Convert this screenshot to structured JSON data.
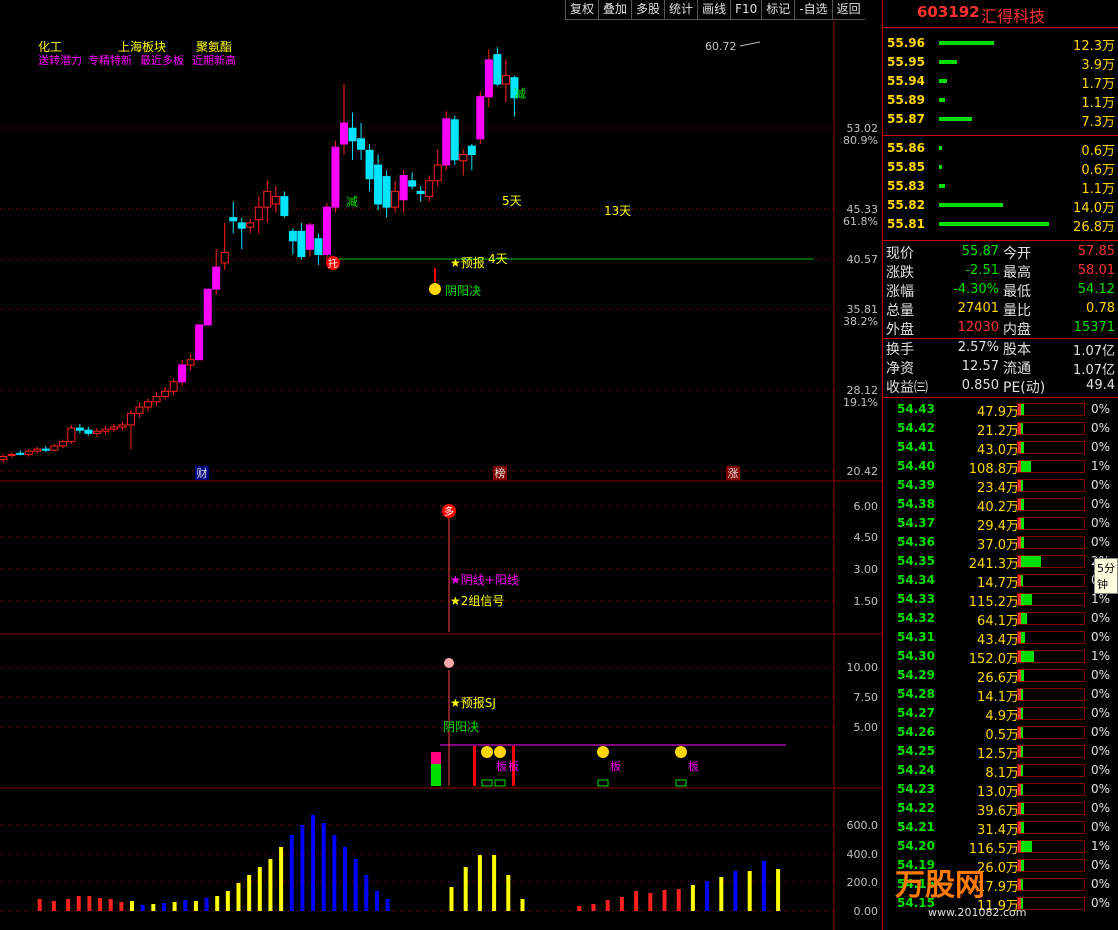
{
  "toolbar": [
    "复权",
    "叠加",
    "多股",
    "统计",
    "画线",
    "F10",
    "标记",
    "-自选",
    "返回"
  ],
  "stock": {
    "code": "603192",
    "name": "汇得科技"
  },
  "main_chart": {
    "legend_row1": [
      "化工",
      "上海板块",
      "聚氨酯"
    ],
    "legend_row2": [
      "送转潜力",
      "专精特新",
      "最近多板",
      "近期新高"
    ],
    "yaxis": [
      {
        "value": "53.02",
        "pct": "80.9%"
      },
      {
        "value": "45.33",
        "pct": "61.8%"
      },
      {
        "value": "40.57",
        "pct": ""
      },
      {
        "value": "35.81",
        "pct": "38.2%"
      },
      {
        "value": "28.12",
        "pct": "19.1%"
      },
      {
        "value": "20.42",
        "pct": ""
      }
    ],
    "high_label": "60.72",
    "annotations": {
      "jian1": "减",
      "jian2": "减",
      "tuo": "托",
      "yubao": "★预报",
      "yinyang": "阴阳决",
      "d5": "5天",
      "d4": "4天",
      "d13": "13天"
    },
    "bottom_markers": [
      "财",
      "榜",
      "涨"
    ]
  },
  "indicator1": {
    "yaxis": [
      "6.00",
      "4.50",
      "3.00",
      "1.50"
    ],
    "marker": "多",
    "labels": [
      "★阴线+阳线",
      "★2组信号"
    ]
  },
  "indicator2": {
    "yaxis": [
      "10.00",
      "7.50",
      "5.00"
    ],
    "labels": {
      "yubao": "★预报SJ",
      "yinyang": "阴阳决",
      "ban": "板"
    }
  },
  "volume": {
    "yaxis": [
      "600.0",
      "400.0",
      "200.0",
      "0.00"
    ]
  },
  "sell_levels": [
    {
      "price": "55.96",
      "vol": "12.3万",
      "bar": 0.5
    },
    {
      "price": "55.95",
      "vol": "3.9万",
      "bar": 0.16
    },
    {
      "price": "55.94",
      "vol": "1.7万",
      "bar": 0.07
    },
    {
      "price": "55.89",
      "vol": "1.1万",
      "bar": 0.05
    },
    {
      "price": "55.87",
      "vol": "7.3万",
      "bar": 0.3
    }
  ],
  "buy_levels": [
    {
      "price": "55.86",
      "vol": "0.6万",
      "bar": 0.03
    },
    {
      "price": "55.85",
      "vol": "0.6万",
      "bar": 0.03
    },
    {
      "price": "55.83",
      "vol": "1.1万",
      "bar": 0.05
    },
    {
      "price": "55.82",
      "vol": "14.0万",
      "bar": 0.58
    },
    {
      "price": "55.81",
      "vol": "26.8万",
      "bar": 1.0
    }
  ],
  "quote": [
    {
      "l1": "现价",
      "v1": "55.87",
      "c1": "grn",
      "l2": "今开",
      "v2": "57.85",
      "c2": "red"
    },
    {
      "l1": "涨跌",
      "v1": "-2.51",
      "c1": "grn",
      "l2": "最高",
      "v2": "58.01",
      "c2": "red"
    },
    {
      "l1": "涨幅",
      "v1": "-4.30%",
      "c1": "grn",
      "l2": "最低",
      "v2": "54.12",
      "c2": "grn"
    },
    {
      "l1": "总量",
      "v1": "27401",
      "c1": "yel",
      "l2": "量比",
      "v2": "0.78",
      "c2": "yel"
    },
    {
      "l1": "外盘",
      "v1": "12030",
      "c1": "red",
      "l2": "内盘",
      "v2": "15371",
      "c2": "grn"
    }
  ],
  "fundamentals": [
    {
      "l1": "换手",
      "v1": "2.57%",
      "l2": "股本",
      "v2": "1.07亿"
    },
    {
      "l1": "净资",
      "v1": "12.57",
      "l2": "流通",
      "v2": "1.07亿"
    },
    {
      "l1": "收益㈢",
      "v1": "0.850",
      "l2": "PE(动)",
      "v2": "49.4"
    }
  ],
  "price_levels": [
    {
      "p": "54.43",
      "v": "47.9万",
      "f": 0.05,
      "pct": "0%"
    },
    {
      "p": "54.42",
      "v": "21.2万",
      "f": 0.03,
      "pct": "0%"
    },
    {
      "p": "54.41",
      "v": "43.0万",
      "f": 0.05,
      "pct": "0%"
    },
    {
      "p": "54.40",
      "v": "108.8万",
      "f": 0.15,
      "pct": "1%"
    },
    {
      "p": "54.39",
      "v": "23.4万",
      "f": 0.03,
      "pct": "0%"
    },
    {
      "p": "54.38",
      "v": "40.2万",
      "f": 0.05,
      "pct": "0%"
    },
    {
      "p": "54.37",
      "v": "29.4万",
      "f": 0.04,
      "pct": "0%"
    },
    {
      "p": "54.36",
      "v": "37.0万",
      "f": 0.05,
      "pct": "0%"
    },
    {
      "p": "54.35",
      "v": "241.3万",
      "f": 0.3,
      "pct": "2%"
    },
    {
      "p": "54.34",
      "v": "14.7万",
      "f": 0.02,
      "pct": "0%"
    },
    {
      "p": "54.33",
      "v": "115.2万",
      "f": 0.16,
      "pct": "1%"
    },
    {
      "p": "54.32",
      "v": "64.1万",
      "f": 0.09,
      "pct": "0%"
    },
    {
      "p": "54.31",
      "v": "43.4万",
      "f": 0.06,
      "pct": "0%"
    },
    {
      "p": "54.30",
      "v": "152.0万",
      "f": 0.2,
      "pct": "1%"
    },
    {
      "p": "54.29",
      "v": "26.6万",
      "f": 0.04,
      "pct": "0%"
    },
    {
      "p": "54.28",
      "v": "14.1万",
      "f": 0.02,
      "pct": "0%"
    },
    {
      "p": "54.27",
      "v": "4.9万",
      "f": 0.01,
      "pct": "0%"
    },
    {
      "p": "54.26",
      "v": "0.5万",
      "f": 0.005,
      "pct": "0%"
    },
    {
      "p": "54.25",
      "v": "12.5万",
      "f": 0.02,
      "pct": "0%"
    },
    {
      "p": "54.24",
      "v": "8.1万",
      "f": 0.01,
      "pct": "0%"
    },
    {
      "p": "54.23",
      "v": "13.0万",
      "f": 0.02,
      "pct": "0%"
    },
    {
      "p": "54.22",
      "v": "39.6万",
      "f": 0.05,
      "pct": "0%"
    },
    {
      "p": "54.21",
      "v": "31.4万",
      "f": 0.04,
      "pct": "0%"
    },
    {
      "p": "54.20",
      "v": "116.5万",
      "f": 0.16,
      "pct": "1%"
    },
    {
      "p": "54.19",
      "v": "26.0万",
      "f": 0.04,
      "pct": "0%"
    },
    {
      "p": "54.16",
      "v": "17.9万",
      "f": 0.03,
      "pct": "0%"
    },
    {
      "p": "54.15",
      "v": "11.9万",
      "f": 0.02,
      "pct": "0%"
    }
  ],
  "tooltip": "5分钟",
  "watermark": {
    "brand": "万股网",
    "url": "www.201082.com"
  },
  "colors": {
    "up": "#ff00ff",
    "down": "#00e5ff",
    "grid": "#8b0000",
    "volume_red": "#ff2020",
    "volume_yellow": "#ffff00",
    "volume_blue": "#0000ff"
  },
  "candles": [
    [
      42.0,
      21.5,
      21.8,
      21.2,
      22.0
    ],
    [
      43.2,
      21.9,
      22.0,
      21.7,
      22.2
    ],
    [
      44.4,
      22.1,
      22.0,
      21.9,
      22.4
    ],
    [
      45.6,
      22.0,
      22.3,
      21.8,
      22.5
    ],
    [
      46.8,
      22.3,
      22.5,
      22.1,
      22.7
    ],
    [
      48.0,
      22.5,
      22.4,
      22.2,
      22.8
    ],
    [
      49.2,
      22.4,
      22.8,
      22.3,
      23.0
    ],
    [
      50.4,
      22.8,
      23.2,
      22.6,
      23.4
    ],
    [
      51.6,
      23.2,
      24.5,
      23.0,
      24.8
    ],
    [
      52.8,
      24.5,
      24.3,
      24.0,
      24.9
    ],
    [
      54.0,
      24.3,
      24.0,
      23.8,
      24.6
    ],
    [
      55.2,
      24.0,
      24.2,
      23.7,
      24.5
    ],
    [
      56.4,
      24.2,
      24.4,
      23.9,
      24.7
    ],
    [
      57.6,
      24.4,
      24.6,
      24.1,
      24.9
    ],
    [
      58.8,
      24.6,
      24.8,
      24.3,
      25.1
    ],
    [
      60.0,
      24.8,
      25.9,
      22.5,
      26.2
    ],
    [
      61.2,
      25.9,
      26.5,
      25.5,
      26.9
    ],
    [
      62.4,
      26.5,
      27.0,
      26.1,
      27.3
    ],
    [
      63.6,
      27.0,
      27.5,
      26.6,
      27.9
    ],
    [
      64.8,
      27.5,
      28.0,
      27.2,
      28.4
    ],
    [
      66.0,
      28.0,
      28.9,
      27.6,
      29.2
    ],
    [
      67.2,
      28.9,
      30.5,
      28.5,
      31.0
    ],
    [
      68.4,
      30.5,
      31.0,
      30.0,
      31.5
    ],
    [
      69.6,
      31.0,
      34.3,
      31.0,
      34.3
    ],
    [
      70.8,
      34.3,
      37.7,
      34.3,
      37.7
    ],
    [
      72.0,
      37.7,
      39.8,
      37.2,
      41.5
    ],
    [
      73.2,
      40.2,
      41.2,
      39.5,
      44.0
    ],
    [
      74.4,
      44.5,
      44.2,
      43.0,
      46.0
    ],
    [
      75.6,
      44.0,
      43.5,
      41.5,
      44.5
    ],
    [
      76.8,
      43.6,
      44.0,
      43.0,
      44.4
    ],
    [
      78.0,
      44.3,
      45.5,
      43.0,
      46.5
    ],
    [
      79.2,
      45.5,
      47.0,
      44.0,
      48.0
    ],
    [
      80.4,
      45.8,
      46.5,
      45.0,
      47.5
    ],
    [
      81.6,
      46.5,
      44.7,
      44.5,
      47.0
    ],
    [
      82.8,
      43.2,
      42.3,
      41.0,
      43.5
    ],
    [
      84.0,
      43.2,
      40.8,
      40.5,
      44.0
    ],
    [
      85.2,
      41.5,
      43.8,
      40.8,
      44.0
    ],
    [
      86.4,
      42.5,
      41.0,
      40.0,
      43.0
    ],
    [
      87.6,
      41.0,
      45.5,
      40.5,
      45.9
    ],
    [
      88.8,
      45.5,
      51.2,
      45.0,
      51.8
    ],
    [
      90.0,
      51.5,
      53.5,
      50.5,
      57.2
    ],
    [
      91.2,
      53.0,
      51.8,
      50.0,
      54.5
    ],
    [
      92.4,
      52.0,
      51.0,
      50.0,
      53.5
    ],
    [
      93.6,
      50.9,
      48.2,
      47.0,
      51.5
    ],
    [
      94.8,
      49.5,
      45.8,
      45.2,
      50.5
    ],
    [
      96.0,
      48.4,
      45.5,
      44.5,
      49.0
    ],
    [
      97.2,
      45.5,
      47.0,
      45.0,
      48.0
    ],
    [
      98.4,
      46.2,
      48.5,
      45.0,
      49.0
    ],
    [
      99.6,
      48.0,
      47.5,
      47.2,
      48.8
    ],
    [
      100.8,
      47.0,
      46.8,
      46.0,
      47.5
    ],
    [
      102.0,
      46.5,
      48.0,
      46.0,
      48.5
    ],
    [
      103.2,
      48.0,
      49.5,
      47.5,
      51.0
    ],
    [
      104.4,
      49.5,
      53.9,
      49.0,
      54.6
    ],
    [
      105.6,
      53.8,
      50.0,
      49.5,
      54.2
    ],
    [
      106.8,
      49.9,
      50.5,
      48.5,
      51.0
    ],
    [
      108.0,
      51.3,
      50.5,
      49.0,
      51.5
    ],
    [
      109.2,
      52.0,
      56.0,
      51.5,
      56.5
    ],
    [
      110.4,
      56.0,
      59.5,
      55.0,
      60.5
    ],
    [
      111.6,
      60.0,
      57.2,
      57.0,
      60.7
    ],
    [
      112.8,
      57.2,
      58.0,
      55.5,
      59.5
    ],
    [
      114.0,
      57.8,
      55.9,
      54.1,
      58.0
    ]
  ],
  "indicator_volume": [
    [
      7,
      6.0
    ],
    [
      9,
      5.0
    ],
    [
      11,
      6.0
    ],
    [
      12.5,
      7.5
    ],
    [
      14,
      7.5
    ],
    [
      15.5,
      6.5
    ],
    [
      17,
      6.0
    ],
    [
      18.5,
      4.5
    ],
    [
      20,
      5.0
    ],
    [
      21.5,
      3.0
    ],
    [
      23,
      3.5
    ],
    [
      24.5,
      4.0
    ],
    [
      26,
      4.5
    ],
    [
      27.5,
      5.5
    ],
    [
      29,
      5.0
    ],
    [
      30.5,
      6.5
    ],
    [
      32,
      7.5
    ],
    [
      33.5,
      10.0
    ],
    [
      35,
      14.0
    ],
    [
      36.5,
      18.0
    ],
    [
      38,
      22.0
    ],
    [
      39.5,
      26.0
    ],
    [
      41,
      32.0
    ],
    [
      42.5,
      38.0
    ],
    [
      44,
      43.0
    ],
    [
      45.5,
      48.0
    ],
    [
      47,
      44.0
    ],
    [
      48.5,
      38.0
    ],
    [
      50,
      32.0
    ],
    [
      51.5,
      26.0
    ],
    [
      53,
      18.0
    ],
    [
      54.5,
      10.0
    ],
    [
      56,
      6.0
    ],
    [
      65,
      12.0
    ],
    [
      67,
      22.0
    ],
    [
      69,
      28.0
    ],
    [
      71,
      28.0
    ],
    [
      73,
      18.0
    ],
    [
      75,
      6.0
    ],
    [
      83,
      2.5
    ],
    [
      85,
      3.5
    ],
    [
      87,
      5.5
    ],
    [
      89,
      7.0
    ],
    [
      91,
      10.0
    ],
    [
      93,
      9.0
    ],
    [
      95,
      10.5
    ],
    [
      97,
      11.0
    ],
    [
      99,
      13.0
    ],
    [
      101,
      15.0
    ],
    [
      103,
      17.0
    ],
    [
      105,
      20.0
    ],
    [
      107,
      20.0
    ],
    [
      109,
      25.0
    ],
    [
      111,
      21.0
    ]
  ]
}
